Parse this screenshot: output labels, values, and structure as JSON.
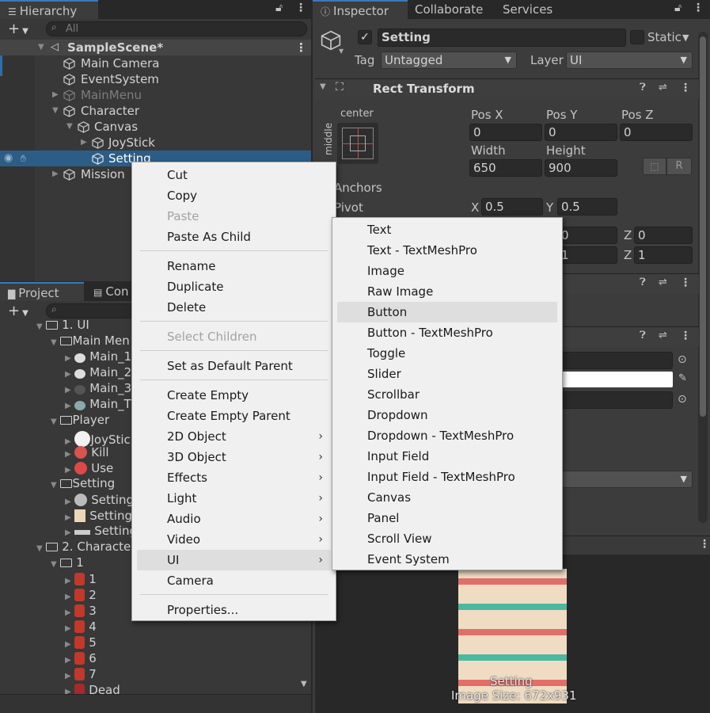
{
  "hierarchy": {
    "tab_label": "Hierarchy",
    "search_placeholder": "All",
    "items": [
      {
        "label": "SampleScene*"
      },
      {
        "label": "Main Camera"
      },
      {
        "label": "EventSystem"
      },
      {
        "label": "MainMenu"
      },
      {
        "label": "Character"
      },
      {
        "label": "Canvas"
      },
      {
        "label": "JoyStick"
      },
      {
        "label": "Setting"
      },
      {
        "label": "Mission"
      }
    ]
  },
  "project": {
    "tab_label": "Project",
    "console_tab_label": "Con",
    "items": [
      {
        "label": "1. UI"
      },
      {
        "label": "Main Men"
      },
      {
        "label": "Main_1"
      },
      {
        "label": "Main_2"
      },
      {
        "label": "Main_3"
      },
      {
        "label": "Main_T"
      },
      {
        "label": "Player"
      },
      {
        "label": "JoyStic"
      },
      {
        "label": "Kill"
      },
      {
        "label": "Use"
      },
      {
        "label": "Setting"
      },
      {
        "label": "Setting"
      },
      {
        "label": "Setting"
      },
      {
        "label": "Setting"
      },
      {
        "label": "2. Characte"
      },
      {
        "label": "1"
      },
      {
        "label": "1"
      },
      {
        "label": "2"
      },
      {
        "label": "3"
      },
      {
        "label": "4"
      },
      {
        "label": "5"
      },
      {
        "label": "6"
      },
      {
        "label": "7"
      },
      {
        "label": "Dead"
      }
    ]
  },
  "inspector": {
    "tabs": [
      "Inspector",
      "Collaborate",
      "Services"
    ],
    "object_name": "Setting",
    "static_label": "Static",
    "tag_label": "Tag",
    "tag_value": "Untagged",
    "layer_label": "Layer",
    "layer_value": "UI",
    "rect_transform_title": "Rect Transform",
    "anchor_h": "center",
    "anchor_v": "middle",
    "pos_x_label": "Pos X",
    "pos_y_label": "Pos Y",
    "pos_z_label": "Pos Z",
    "pos_x": "0",
    "pos_y": "0",
    "pos_z": "0",
    "width_label": "Width",
    "height_label": "Height",
    "width": "650",
    "height": "900",
    "r_button": "R",
    "anchors_label": "Anchors",
    "pivot_label": "Pivot",
    "pivot_x_label": "X",
    "pivot_y_label": "Y",
    "pivot_x": "0.5",
    "pivot_y": "0.5",
    "rot_y_partial": "0",
    "rot_z_label": "Z",
    "rot_z": "0",
    "scale_y_partial": "1",
    "scale_z_label": "Z",
    "scale_z": "1",
    "preview_name": "Setting",
    "preview_size": "Image Size: 672x931"
  },
  "context_menu": {
    "items": [
      {
        "label": "Cut",
        "disabled": false
      },
      {
        "label": "Copy",
        "disabled": false
      },
      {
        "label": "Paste",
        "disabled": true
      },
      {
        "label": "Paste As Child",
        "disabled": false
      },
      {
        "label": "Rename",
        "disabled": false
      },
      {
        "label": "Duplicate",
        "disabled": false
      },
      {
        "label": "Delete",
        "disabled": false
      },
      {
        "label": "Select Children",
        "disabled": true
      },
      {
        "label": "Set as Default Parent",
        "disabled": false
      },
      {
        "label": "Create Empty",
        "disabled": false
      },
      {
        "label": "Create Empty Parent",
        "disabled": false
      },
      {
        "label": "2D Object",
        "submenu": true
      },
      {
        "label": "3D Object",
        "submenu": true
      },
      {
        "label": "Effects",
        "submenu": true
      },
      {
        "label": "Light",
        "submenu": true
      },
      {
        "label": "Audio",
        "submenu": true
      },
      {
        "label": "Video",
        "submenu": true
      },
      {
        "label": "UI",
        "submenu": true
      },
      {
        "label": "Camera",
        "disabled": false
      },
      {
        "label": "Properties...",
        "disabled": false
      }
    ]
  },
  "ui_submenu": {
    "items": [
      {
        "label": "Text"
      },
      {
        "label": "Text - TextMeshPro"
      },
      {
        "label": "Image"
      },
      {
        "label": "Raw Image"
      },
      {
        "label": "Button"
      },
      {
        "label": "Button - TextMeshPro"
      },
      {
        "label": "Toggle"
      },
      {
        "label": "Slider"
      },
      {
        "label": "Scrollbar"
      },
      {
        "label": "Dropdown"
      },
      {
        "label": "Dropdown - TextMeshPro"
      },
      {
        "label": "Input Field"
      },
      {
        "label": "Input Field - TextMeshPro"
      },
      {
        "label": "Canvas"
      },
      {
        "label": "Panel"
      },
      {
        "label": "Scroll View"
      },
      {
        "label": "Event System"
      }
    ]
  },
  "colors": {
    "selection": "#2c5d87",
    "accent_tab": "#3a79bb",
    "menu_bg": "#f0f0f0"
  }
}
